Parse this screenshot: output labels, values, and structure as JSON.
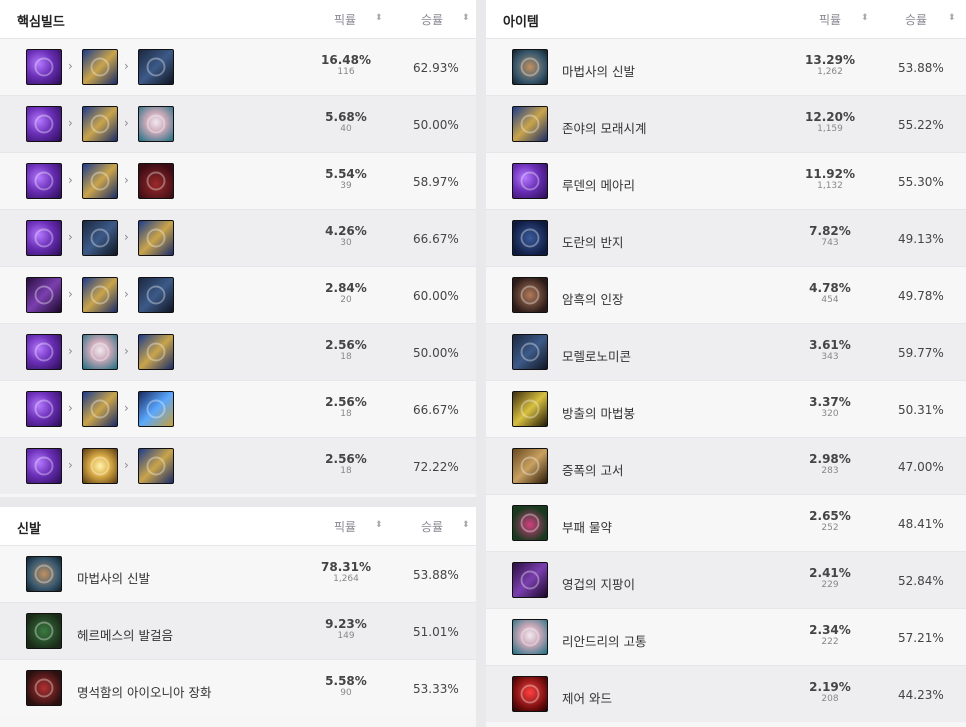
{
  "core": {
    "title": "핵심빌드",
    "col_pick": "픽률",
    "col_win": "승률",
    "rows": [
      {
        "icons": [
          "c-purple",
          "c-hour",
          "c-dark"
        ],
        "pick": "16.48%",
        "count": "116",
        "win": "62.93%"
      },
      {
        "icons": [
          "c-purple",
          "c-hour",
          "c-mask"
        ],
        "pick": "5.68%",
        "count": "40",
        "win": "50.00%"
      },
      {
        "icons": [
          "c-purple",
          "c-hour",
          "c-hat"
        ],
        "pick": "5.54%",
        "count": "39",
        "win": "58.97%"
      },
      {
        "icons": [
          "c-purple",
          "c-dark",
          "c-hour"
        ],
        "pick": "4.26%",
        "count": "30",
        "win": "66.67%"
      },
      {
        "icons": [
          "c-staff",
          "c-hour",
          "c-dark"
        ],
        "pick": "2.84%",
        "count": "20",
        "win": "60.00%"
      },
      {
        "icons": [
          "c-purple",
          "c-mask",
          "c-hour"
        ],
        "pick": "2.56%",
        "count": "18",
        "win": "50.00%"
      },
      {
        "icons": [
          "c-purple",
          "c-hour",
          "c-blue"
        ],
        "pick": "2.56%",
        "count": "18",
        "win": "66.67%"
      },
      {
        "icons": [
          "c-purple",
          "c-gold",
          "c-hour"
        ],
        "pick": "2.56%",
        "count": "18",
        "win": "72.22%"
      }
    ]
  },
  "boots": {
    "title": "신발",
    "col_pick": "픽률",
    "col_win": "승률",
    "rows": [
      {
        "icon": "c-boots",
        "name": "마법사의 신발",
        "pick": "78.31%",
        "count": "1,264",
        "win": "53.88%"
      },
      {
        "icon": "c-merc",
        "name": "헤르메스의 발걸음",
        "pick": "9.23%",
        "count": "149",
        "win": "51.01%"
      },
      {
        "icon": "c-ionian",
        "name": "명석함의 아이오니아 장화",
        "pick": "5.58%",
        "count": "90",
        "win": "53.33%"
      }
    ]
  },
  "items": {
    "title": "아이템",
    "col_pick": "픽률",
    "col_win": "승률",
    "rows": [
      {
        "icon": "c-boots",
        "name": "마법사의 신발",
        "pick": "13.29%",
        "count": "1,262",
        "win": "53.88%"
      },
      {
        "icon": "c-zhonya",
        "name": "존야의 모래시계",
        "pick": "12.20%",
        "count": "1,159",
        "win": "55.22%"
      },
      {
        "icon": "c-purple",
        "name": "루덴의 메아리",
        "pick": "11.92%",
        "count": "1,132",
        "win": "55.30%"
      },
      {
        "icon": "c-ring",
        "name": "도란의 반지",
        "pick": "7.82%",
        "count": "743",
        "win": "49.13%"
      },
      {
        "icon": "c-seal",
        "name": "암흑의 인장",
        "pick": "4.78%",
        "count": "454",
        "win": "49.78%"
      },
      {
        "icon": "c-dark",
        "name": "모렐로노미콘",
        "pick": "3.61%",
        "count": "343",
        "win": "59.77%"
      },
      {
        "icon": "c-wand",
        "name": "방출의 마법봉",
        "pick": "3.37%",
        "count": "320",
        "win": "50.31%"
      },
      {
        "icon": "c-book",
        "name": "증폭의 고서",
        "pick": "2.98%",
        "count": "283",
        "win": "47.00%"
      },
      {
        "icon": "c-flask",
        "name": "부패 물약",
        "pick": "2.65%",
        "count": "252",
        "win": "48.41%"
      },
      {
        "icon": "c-staff",
        "name": "영겁의 지팡이",
        "pick": "2.41%",
        "count": "229",
        "win": "52.84%"
      },
      {
        "icon": "c-mask",
        "name": "리안드리의 고통",
        "pick": "2.34%",
        "count": "222",
        "win": "57.21%"
      },
      {
        "icon": "c-red",
        "name": "제어 와드",
        "pick": "2.19%",
        "count": "208",
        "win": "44.23%"
      }
    ]
  },
  "sort_glyph": "⬍",
  "arrow_glyph": "›"
}
